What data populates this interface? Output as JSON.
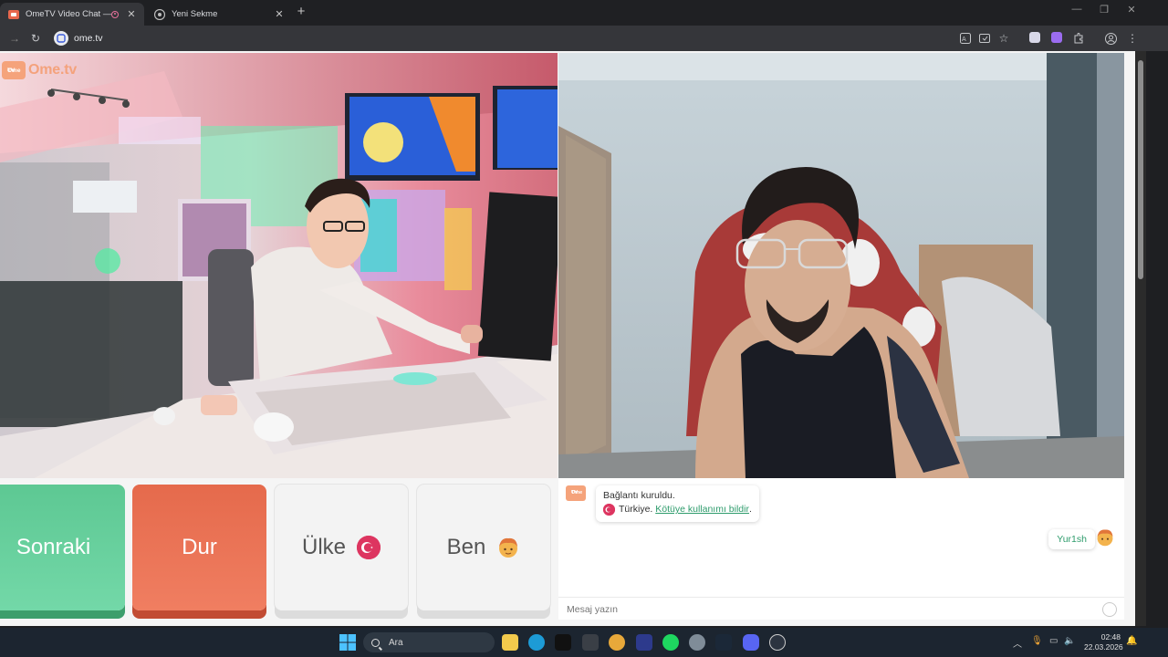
{
  "browser": {
    "tabs": [
      {
        "title": "OmeTV Video Chat — Omegl",
        "active": true
      },
      {
        "title": "Yeni Sekme",
        "active": false
      }
    ],
    "url": "ome.tv",
    "new_tab_label": "+",
    "close_label": "✕"
  },
  "logo": {
    "icon_text_top": "Ome",
    "icon_text_bottom": "TV",
    "wordmark": "Ome.tv"
  },
  "controls": {
    "next_label": "Sonraki",
    "stop_label": "Dur",
    "country_label": "Ülke",
    "me_label": "Ben"
  },
  "chat": {
    "system_line1": "Bağlantı kuruldu.",
    "system_country": "Türkiye.",
    "report_link": "Kötüye kullanımı bildir",
    "report_suffix": ".",
    "my_name": "Yur1sh",
    "input_placeholder": "Mesaj yazın"
  },
  "taskbar": {
    "search_label": "Ara",
    "time": "02:48",
    "date": "22.03.2026"
  },
  "colors": {
    "next": "#5dc893",
    "stop": "#e56a4c",
    "accent_link": "#2e9c6c",
    "turkey_red": "#dd3560"
  }
}
